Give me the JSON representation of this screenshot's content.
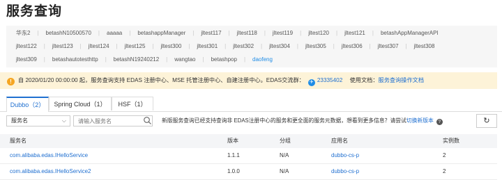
{
  "page_title": "服务查询",
  "namespaces": {
    "row1": [
      "华东2",
      "betashN10500570",
      "aaaaa",
      "betashappManager",
      "jltest117",
      "jltest118",
      "jltest119",
      "jltest120",
      "jltest121",
      "betashAppManagerAPI"
    ],
    "row2": [
      "jltest122",
      "jltest123",
      "jltest124",
      "jltest125",
      "jltest300",
      "jltest301",
      "jltest302",
      "jltest304",
      "jltest305",
      "jltest306",
      "jltest307",
      "jltest308"
    ],
    "row3": [
      "jltest309",
      "betashautotesthttp",
      "betashN19240212",
      "wangtao",
      "betashpop",
      "daofeng"
    ],
    "active": "daofeng"
  },
  "notice": {
    "text": "自 2020/01/20 00:00:00 起，服务查询支持 EDAS 注册中心、MSE 托管注册中心、自建注册中心。EDAS交流群：",
    "group_number": "23335402",
    "doc_prefix": "使用文档：",
    "doc_link": "服务查询操作文档"
  },
  "tabs": [
    {
      "label": "Dubbo（2）"
    },
    {
      "label": "Spring Cloud（1）"
    },
    {
      "label": "HSF（1）"
    }
  ],
  "search": {
    "select_value": "服务名",
    "placeholder": "请输入服务名"
  },
  "info": {
    "text": "新版服务查询已经支持查询非 EDAS注册中心的服务和更全面的服务元数据，想看到更多信息？请尝试",
    "link": "切换新版本"
  },
  "table": {
    "headers": [
      "服务名",
      "版本",
      "分组",
      "应用名",
      "实例数"
    ],
    "rows": [
      [
        "com.alibaba.edas.IHelloService",
        "1.1.1",
        "N/A",
        "dubbo-cs-p",
        "2"
      ],
      [
        "com.alibaba.edas.IHelloService2",
        "1.0.0",
        "N/A",
        "dubbo-cs-p",
        "2"
      ]
    ]
  }
}
